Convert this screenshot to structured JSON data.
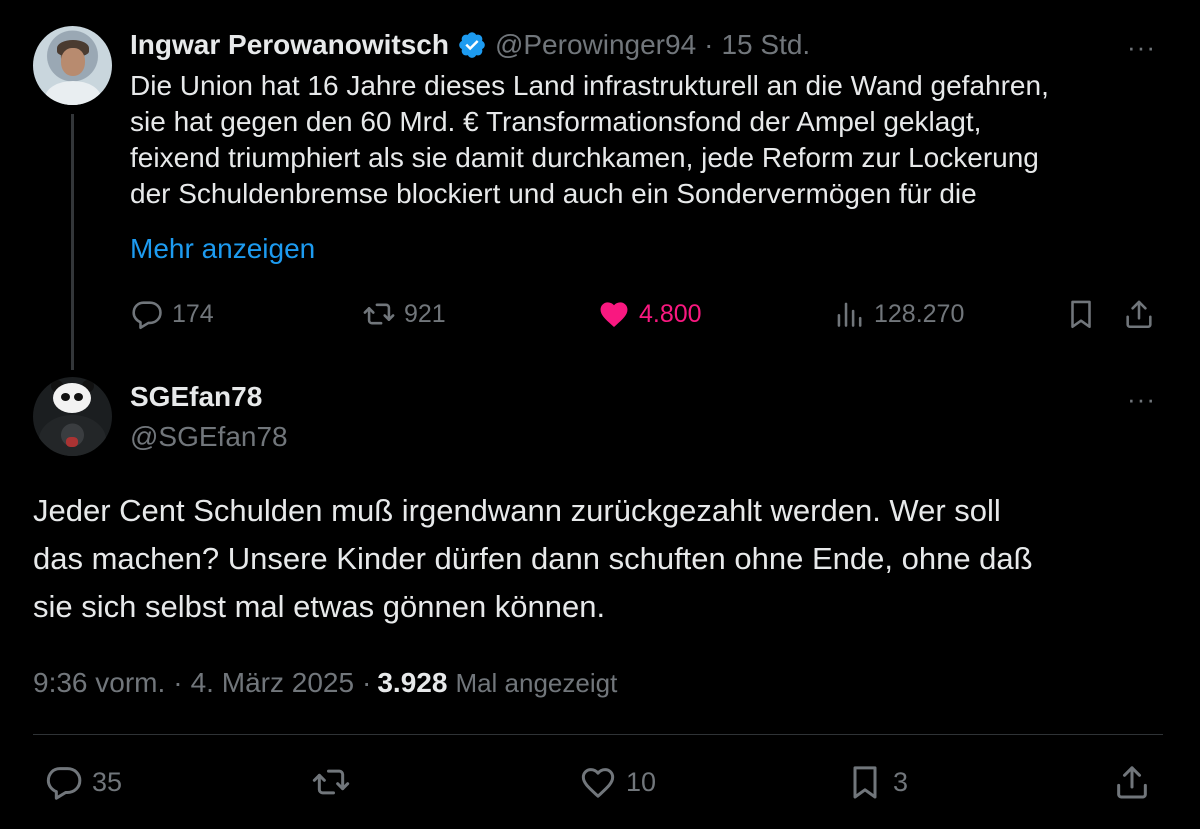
{
  "parent_tweet": {
    "display_name": "Ingwar Perowanowitsch",
    "handle": "@Perowinger94",
    "time": "15 Std.",
    "separator": "·",
    "more": "···",
    "text_lines": [
      "Die Union hat 16 Jahre dieses Land infrastrukturell an die Wand gefahren,",
      "sie hat gegen den 60 Mrd. € Transformationsfond der Ampel geklagt,",
      "feixend triumphiert als sie damit durchkamen, jede Reform zur Lockerung",
      "der Schuldenbremse blockiert und auch ein Sondervermögen für die"
    ],
    "show_more": "Mehr anzeigen",
    "actions": {
      "replies": "174",
      "reposts": "921",
      "likes": "4.800",
      "views": "128.270"
    }
  },
  "reply_tweet": {
    "display_name": "SGEfan78",
    "handle": "@SGEfan78",
    "more": "···",
    "text_lines": [
      "Jeder Cent Schulden muß irgendwann zurückgezahlt werden. Wer soll",
      "das machen? Unsere Kinder dürfen dann schuften ohne Ende, ohne daß",
      "sie sich selbst mal etwas gönnen können."
    ],
    "meta": {
      "time": "9:36 vorm.",
      "separator": "·",
      "date": "4. März 2025",
      "separator2": "·",
      "views_count": "3.928",
      "views_label": "Mal angezeigt"
    },
    "actions": {
      "replies": "35",
      "likes": "10",
      "bookmarks": "3"
    }
  },
  "colors": {
    "background": "#000000",
    "text_primary": "#e7e9ea",
    "text_secondary": "#71767b",
    "link": "#1d9bf0",
    "like_active": "#f91880",
    "verified": "#1d9bf0"
  }
}
